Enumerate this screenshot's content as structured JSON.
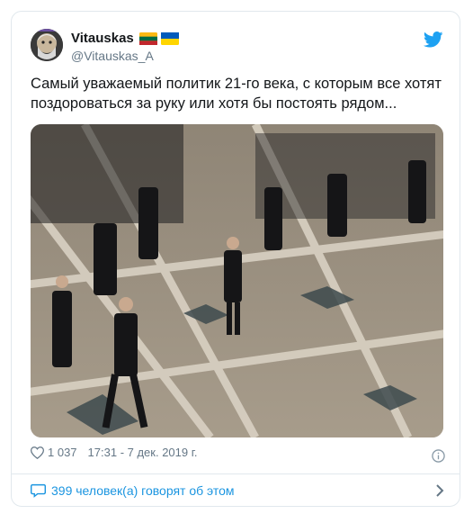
{
  "tweet": {
    "author_name": "Vitauskas",
    "author_handle": "@Vitauskas_A",
    "flags": [
      "lithuania-flag",
      "ukraine-flag"
    ],
    "text_line1": "Самый уважаемый политик 21-го века, с которым все хотят",
    "text_line2": "поздороваться за руку или хотя бы постоять рядом...",
    "likes": "1 037",
    "timestamp": "17:31 - 7 дек. 2019 г.",
    "conversation": "399 человек(а) говорят об этом"
  },
  "icons": {
    "brand": "twitter-bird-icon",
    "like": "heart-icon",
    "info": "info-icon",
    "reply": "speech-bubble-icon",
    "chevron": "chevron-right-icon"
  },
  "colors": {
    "brand": "#1da1f2",
    "link": "#1b95e0",
    "secondary_text": "#657786",
    "border": "#e1e8ed"
  }
}
